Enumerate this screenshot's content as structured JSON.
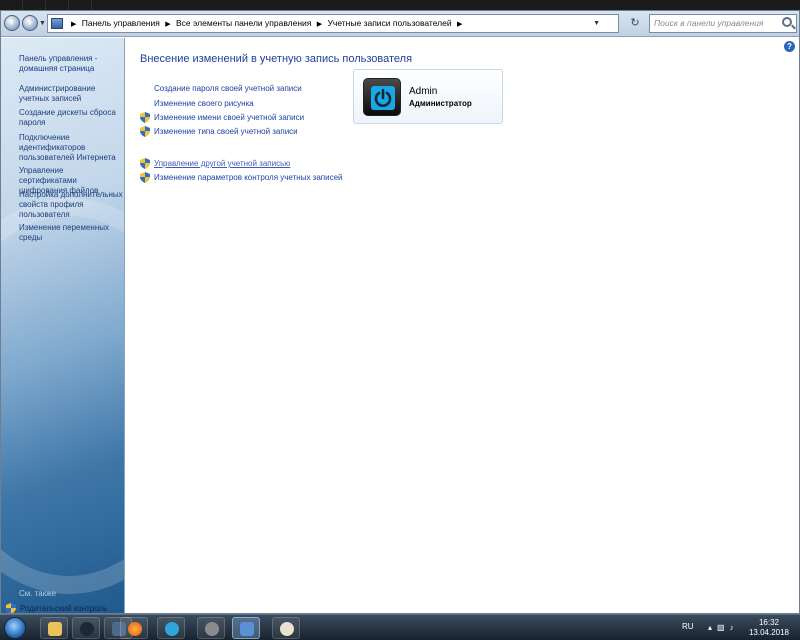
{
  "navigation": {
    "breadcrumbs": [
      "Панель управления",
      "Все элементы панели управления",
      "Учетные записи пользователей"
    ],
    "search_placeholder": "Поиск в панели управления"
  },
  "sidebar": {
    "items": [
      {
        "label": "Панель управления - домашняя страница"
      },
      {
        "label": "Администрирование учетных записей"
      },
      {
        "label": "Создание дискеты сброса пароля"
      },
      {
        "label": "Подключение идентификаторов пользователей Интернета"
      },
      {
        "label": "Управление сертификатами шифрования файлов"
      },
      {
        "label": "Настройка дополнительных свойств профиля пользователя"
      },
      {
        "label": "Изменение переменных среды"
      }
    ],
    "see_also": "См. также",
    "parental_control": "Родительский контроль"
  },
  "main": {
    "title": "Внесение изменений в учетную запись пользователя",
    "tasks": [
      {
        "label": "Создание пароля своей учетной записи",
        "shield": false
      },
      {
        "label": "Изменение своего рисунка",
        "shield": false
      },
      {
        "label": "Изменение имени своей учетной записи",
        "shield": true
      },
      {
        "label": "Изменение типа своей учетной записи",
        "shield": true
      }
    ],
    "other_tasks": [
      {
        "label": "Управление другой учетной записью",
        "shield": true
      },
      {
        "label": "Изменение параметров контроля учетных записей",
        "shield": true
      }
    ],
    "user": {
      "name": "Admin",
      "role": "Администратор"
    }
  },
  "taskbar": {
    "language": "RU",
    "time": "16:32",
    "date": "13.04.2018"
  },
  "colors": {
    "link": "#1f42a8",
    "title": "#1e3f96",
    "accent": "#1aa7e6"
  }
}
